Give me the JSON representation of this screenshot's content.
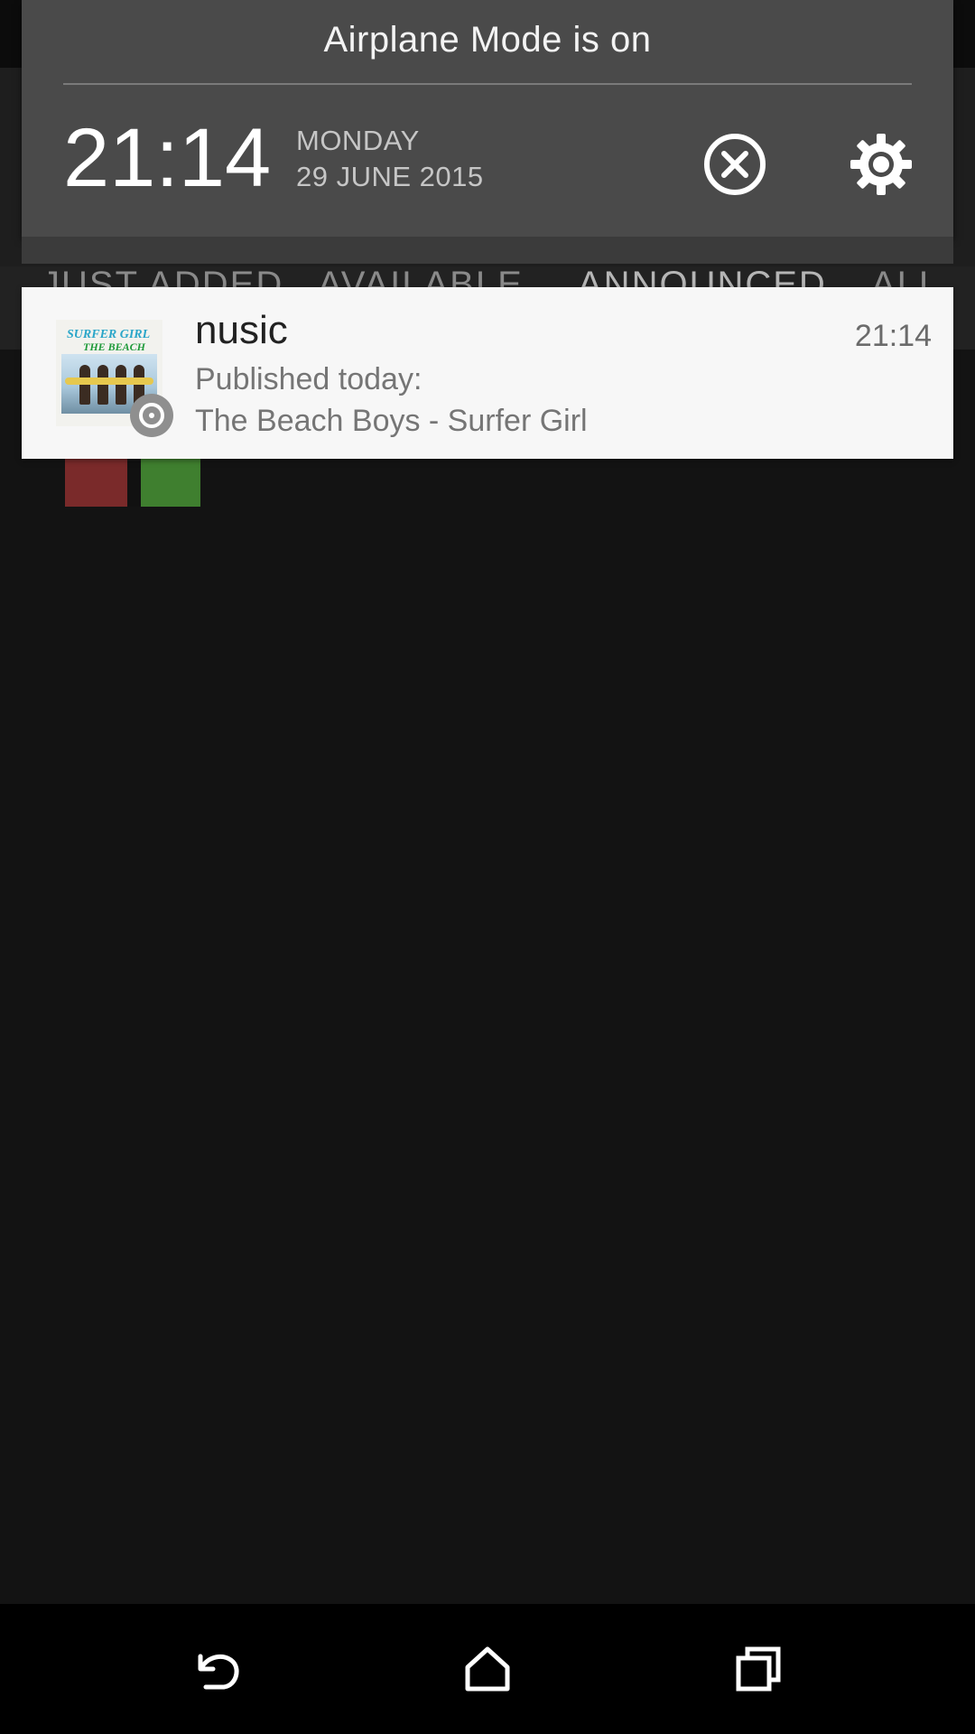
{
  "background_app": {
    "tabs": [
      "JUST ADDED",
      "AVAILABLE",
      "ANNOUNCED",
      "ALL"
    ]
  },
  "shade": {
    "airplane_mode_text": "Airplane Mode is on",
    "time": "21:14",
    "day": "MONDAY",
    "date": "29 JUNE 2015",
    "dismiss_icon": "close-circle-icon",
    "settings_icon": "gear-icon"
  },
  "notification": {
    "app_name": "nusic",
    "time": "21:14",
    "line1": "Published today:",
    "line2": "The Beach Boys - Surfer Girl",
    "album_art": {
      "title": "SURFER GIRL",
      "artist": "THE BEACH BOYS"
    },
    "badge_icon": "disc-icon"
  },
  "navigation": {
    "back_icon": "back-icon",
    "home_icon": "home-icon",
    "recents_icon": "recents-icon"
  },
  "colors": {
    "shade_bg": "#4a4a4a",
    "card_bg": "#f7f7f7",
    "screen_bg": "#131313",
    "nav_bg": "#000000"
  }
}
